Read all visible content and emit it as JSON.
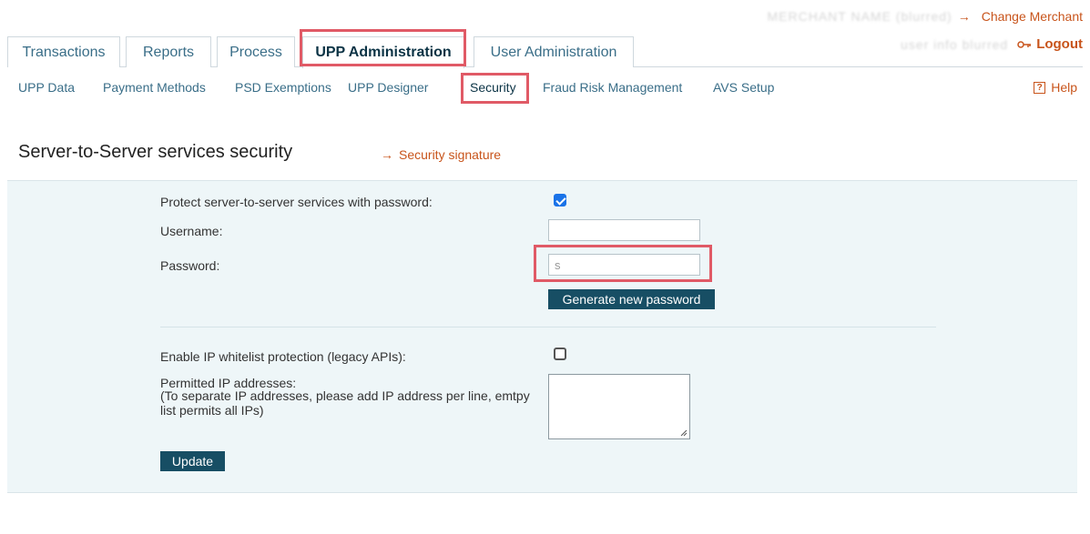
{
  "header": {
    "merchant_blurred": "MERCHANT NAME (blurred)",
    "change_merchant": "Change Merchant",
    "user_blurred": "user info blurred",
    "logout": "Logout"
  },
  "tabs": [
    {
      "label": "Transactions"
    },
    {
      "label": "Reports"
    },
    {
      "label": "Process"
    },
    {
      "label": "UPP Administration"
    },
    {
      "label": "User Administration"
    }
  ],
  "subnav": [
    {
      "label": "UPP Data"
    },
    {
      "label": "Payment Methods"
    },
    {
      "label": "PSD Exemptions"
    },
    {
      "label": "UPP Designer"
    },
    {
      "label": "Security"
    },
    {
      "label": "Fraud Risk Management"
    },
    {
      "label": "AVS Setup"
    }
  ],
  "help": {
    "label": "Help",
    "icon": "?"
  },
  "page": {
    "title": "Server-to-Server services security",
    "signature_link": "Security signature"
  },
  "form": {
    "protect_label": "Protect server-to-server services with password:",
    "protect_checked": true,
    "username_label": "Username:",
    "username_value": "",
    "password_label": "Password:",
    "password_value": "s",
    "generate_button": "Generate new password",
    "ip_whitelist_label": "Enable IP whitelist protection (legacy APIs):",
    "ip_whitelist_checked": false,
    "permitted_label": "Permitted IP addresses:",
    "permitted_hint": "(To separate IP addresses, please add IP address per line, emtpy list permits all IPs)",
    "permitted_value": "",
    "update_button": "Update"
  },
  "colors": {
    "accent_orange": "#c8541b",
    "nav_blue": "#3a6e88",
    "button_teal": "#174e64",
    "panel_bg": "#eef6f8",
    "highlight_red": "#e05a66"
  }
}
